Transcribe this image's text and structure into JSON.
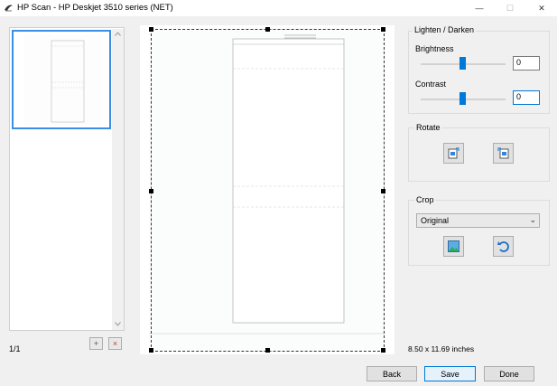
{
  "window": {
    "title": "HP Scan - HP Deskjet 3510 series (NET)",
    "controls": {
      "minimize": "—",
      "maximize": "☐",
      "close": "✕"
    }
  },
  "thumbnails": {
    "page_count": "1/1",
    "add_icon": "+",
    "delete_icon": "×"
  },
  "lighten_darken": {
    "title": "Lighten / Darken",
    "brightness_label": "Brightness",
    "brightness_value": "0",
    "contrast_label": "Contrast",
    "contrast_value": "0"
  },
  "rotate": {
    "title": "Rotate"
  },
  "crop": {
    "title": "Crop",
    "selected": "Original"
  },
  "status": {
    "paper_size": "8.50 x 11.69 inches"
  },
  "buttons": {
    "back": "Back",
    "save": "Save",
    "done": "Done"
  },
  "colors": {
    "accent": "#0078d7",
    "selection": "#3a8ee6"
  }
}
